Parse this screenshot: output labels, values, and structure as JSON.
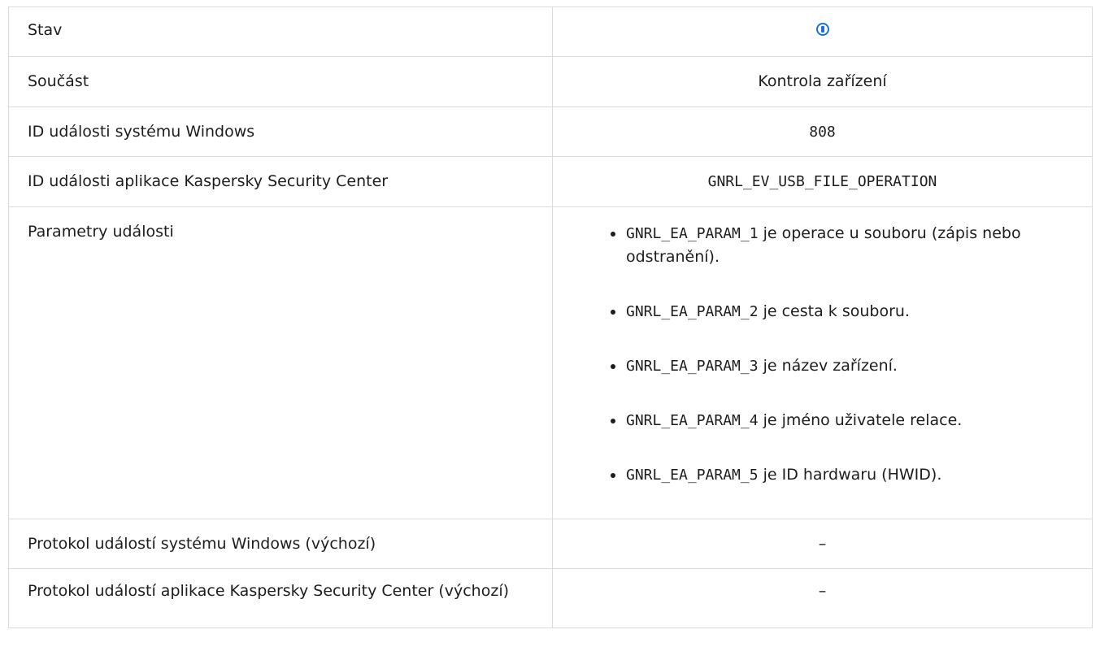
{
  "table": {
    "rows": [
      {
        "label": "Stav",
        "value_icon": "info-icon",
        "icon_color": "#1a73d4"
      },
      {
        "label": "Součást",
        "value": "Kontrola zařízení"
      },
      {
        "label": "ID události systému Windows",
        "value": "808"
      },
      {
        "label": "ID události aplikace Kaspersky Security Center",
        "value": "GNRL_EV_USB_FILE_OPERATION"
      },
      {
        "label": "Parametry události",
        "params": [
          {
            "code": "GNRL_EA_PARAM_1",
            "text": " je operace u souboru (zápis nebo odstranění)."
          },
          {
            "code": "GNRL_EA_PARAM_2",
            "text": " je cesta k souboru."
          },
          {
            "code": "GNRL_EA_PARAM_3",
            "text": " je název zařízení."
          },
          {
            "code": "GNRL_EA_PARAM_4",
            "text": " je jméno uživatele relace."
          },
          {
            "code": "GNRL_EA_PARAM_5",
            "text": " je ID hardwaru (HWID)."
          }
        ]
      },
      {
        "label": "Protokol událostí systému Windows (výchozí)",
        "value": "–"
      },
      {
        "label": "Protokol událostí aplikace Kaspersky Security Center (výchozí)",
        "value": "–"
      }
    ]
  }
}
